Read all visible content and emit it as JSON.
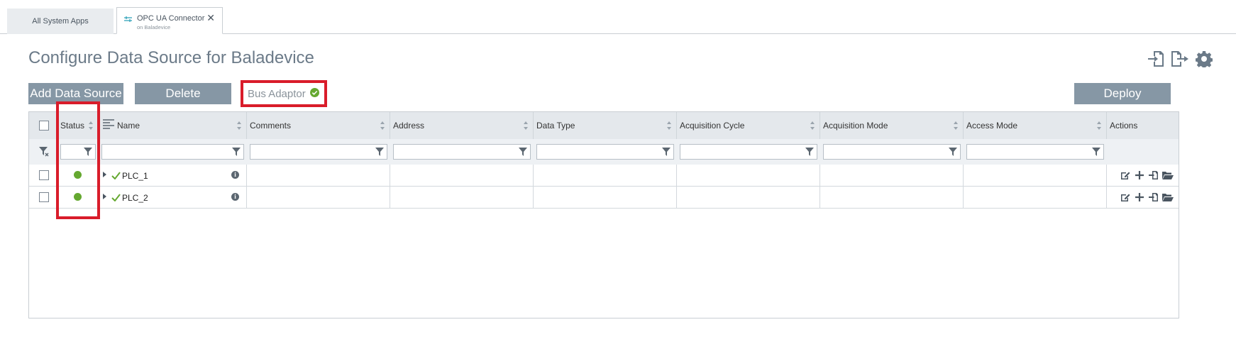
{
  "tabs": [
    {
      "label": "All System Apps",
      "active": false
    },
    {
      "label": "OPC UA Connector",
      "sublabel": "on Baladevice",
      "active": true
    }
  ],
  "page": {
    "title": "Configure Data Source for Baladevice"
  },
  "toolbar": {
    "add_label": "Add Data Source",
    "delete_label": "Delete",
    "bus_adaptor_label": "Bus Adaptor",
    "deploy_label": "Deploy",
    "icons": [
      "import-icon",
      "export-icon",
      "settings-gear-icon"
    ]
  },
  "grid": {
    "columns": [
      "Status",
      "Name",
      "Comments",
      "Address",
      "Data Type",
      "Acquisition Cycle",
      "Acquisition Mode",
      "Access Mode",
      "Actions"
    ],
    "rows": [
      {
        "status": "connected",
        "name": "PLC_1"
      },
      {
        "status": "connected",
        "name": "PLC_2"
      }
    ],
    "row_actions": [
      "edit-icon",
      "add-icon",
      "import-icon",
      "open-folder-icon"
    ]
  },
  "colors": {
    "button_bg": "#8697a5",
    "status_ok": "#65a830",
    "highlight": "#d91c2a",
    "title": "#6b7a88"
  }
}
